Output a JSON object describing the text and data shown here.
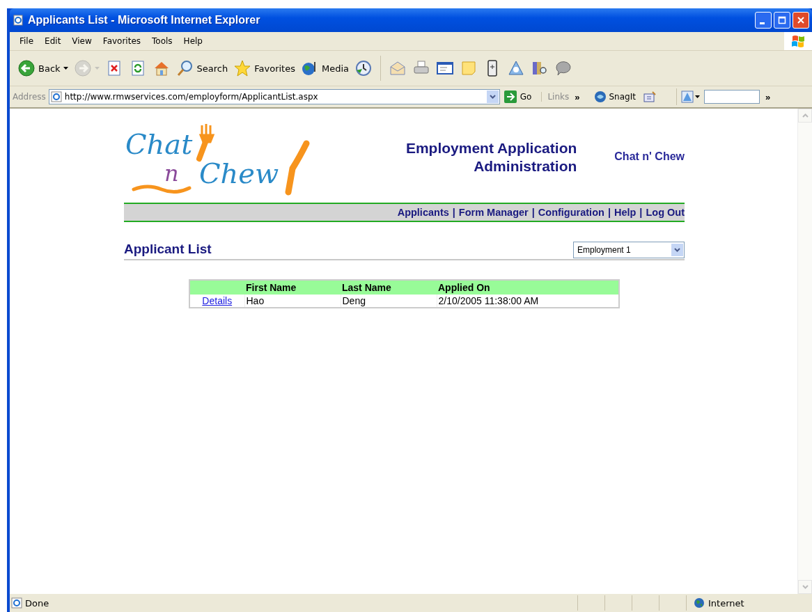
{
  "window": {
    "title": "Applicants List - Microsoft Internet Explorer"
  },
  "menu": [
    "File",
    "Edit",
    "View",
    "Favorites",
    "Tools",
    "Help"
  ],
  "toolbar": [
    {
      "kind": "back",
      "label": "Back",
      "disabled": false
    },
    {
      "kind": "forward",
      "disabled": true
    },
    {
      "kind": "stop",
      "disabled": false
    },
    {
      "kind": "refresh",
      "disabled": false
    },
    {
      "kind": "home",
      "disabled": false
    },
    {
      "kind": "search",
      "label": "Search",
      "disabled": false
    },
    {
      "kind": "favorites",
      "label": "Favorites",
      "disabled": false
    },
    {
      "kind": "media",
      "label": "Media",
      "disabled": false
    },
    {
      "kind": "history",
      "disabled": false
    },
    {
      "kind": "mail",
      "disabled": false
    },
    {
      "kind": "print",
      "disabled": false
    },
    {
      "kind": "edit",
      "disabled": false
    },
    {
      "kind": "note",
      "disabled": false
    },
    {
      "kind": "device",
      "disabled": false
    },
    {
      "kind": "research",
      "disabled": false
    },
    {
      "kind": "books",
      "disabled": false
    },
    {
      "kind": "chat",
      "disabled": false
    }
  ],
  "address_bar": {
    "label": "Address",
    "url": "http://www.rmwservices.com/employform/ApplicantList.aspx",
    "go": "Go",
    "links": "Links",
    "links_chevron": "»",
    "snagit": "SnagIt",
    "end_chevron": "»"
  },
  "page": {
    "logo": {
      "word_1": "Chat",
      "word_2": "n",
      "word_3": "Chew"
    },
    "heading_line_1": "Employment Application",
    "heading_line_2": "Administration",
    "site_name": "Chat n' Chew",
    "nav": [
      "Applicants",
      "Form Manager",
      "Configuration",
      "Help",
      "Log Out"
    ],
    "nav_separator": "|",
    "section_title": "Applicant List",
    "form_select": {
      "value": "Employment 1"
    },
    "table": {
      "columns": [
        null,
        "First Name",
        "Last Name",
        "Applied On"
      ],
      "rows": [
        {
          "cells": [
            "Details",
            "Hao",
            "Deng",
            "2/10/2005 11:38:00 AM"
          ]
        }
      ]
    }
  },
  "status_bar": {
    "status": "Done",
    "zone": "Internet"
  }
}
